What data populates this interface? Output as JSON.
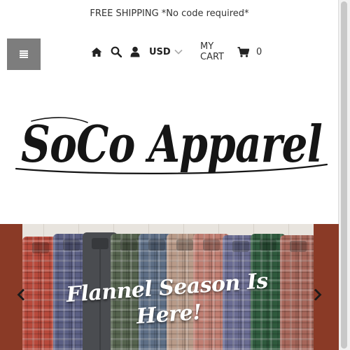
{
  "announcement": {
    "text": "FREE SHIPPING *No code required*"
  },
  "header": {
    "menu_icon": "hamburger-icon",
    "home_icon": "home-icon",
    "search_icon": "search-icon",
    "account_icon": "user-icon",
    "currency": "USD",
    "cart_label": "MY CART",
    "cart_icon": "shopping-cart-icon",
    "cart_count": "0"
  },
  "logo": {
    "text": "SoCo Apparel"
  },
  "hero": {
    "caption_line1": "Flannel Season Is",
    "caption_line2": "Here!",
    "prev_icon": "chevron-left-icon",
    "next_icon": "chevron-right-icon"
  },
  "colors": {
    "menu_button": "#7d7d7d",
    "banner_frame": "#8a3a26",
    "text": "#222222"
  }
}
